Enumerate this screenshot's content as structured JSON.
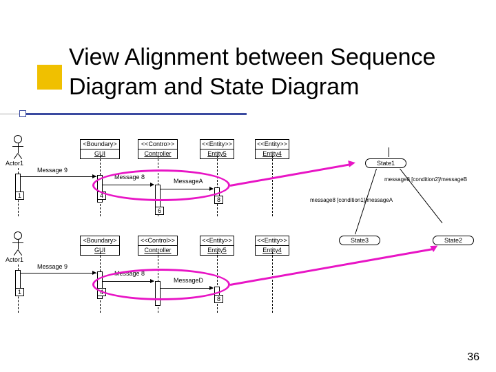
{
  "slide": {
    "title": "View Alignment between Sequence Diagram and State Diagram",
    "number": "36"
  },
  "seq1": {
    "actor": "Actor1",
    "objects": {
      "boundary": {
        "stereo": "<Boundary>",
        "name": "GUI"
      },
      "control": {
        "stereo": "<<Contro>>",
        "name": "Controller"
      },
      "entity5": {
        "stereo": "<<Entity>>",
        "name": "Entity5"
      },
      "entity4": {
        "stereo": "<<Entity>>",
        "name": "Entity4"
      }
    },
    "messages": {
      "m9": "Message 9",
      "m8": "Message 8",
      "ma": "MessageA"
    },
    "nums": {
      "n1": "1",
      "n4": "4",
      "n6": "6",
      "n8": "8"
    }
  },
  "seq2": {
    "actor": "Actor1",
    "objects": {
      "boundary": {
        "stereo": "<Boundary>",
        "name": "GUI"
      },
      "control": {
        "stereo": "<<Control>>",
        "name": "Controller"
      },
      "entity5": {
        "stereo": "<<Entity>>",
        "name": "Entity5"
      },
      "entity4": {
        "stereo": "<<Entity>>",
        "name": "Entity4"
      }
    },
    "messages": {
      "m9": "Message 9",
      "m8": "Message 8",
      "md": "MessageD"
    },
    "nums": {
      "n1": "1",
      "n4": "4",
      "n8": "8"
    }
  },
  "stateDiagram": {
    "state1": "State1",
    "state2": "State2",
    "state3": "State3",
    "trans1": "message8 [condition1]/messageA",
    "trans2": "message8 [condition2]/messageB"
  }
}
